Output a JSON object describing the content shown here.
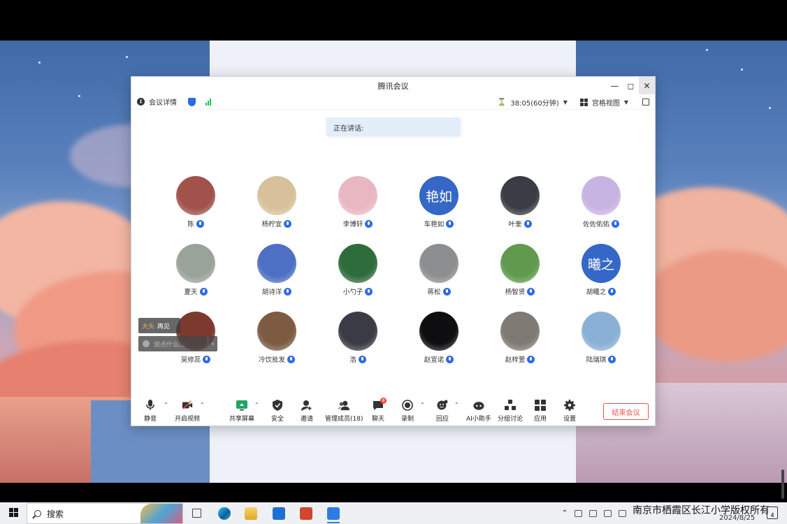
{
  "window": {
    "title": "腾讯会议",
    "meeting_details": "会议详情",
    "timer": "38:05(60分钟)",
    "view_mode": "宫格视图",
    "speaking_label": "正在讲话:"
  },
  "participants": [
    {
      "name": "陈",
      "kind": "photo",
      "color": "#a0524b"
    },
    {
      "name": "杨柠宜",
      "kind": "photo",
      "color": "#d8c09a"
    },
    {
      "name": "李博轩",
      "kind": "photo",
      "color": "#e8b7c2"
    },
    {
      "name": "车艳如",
      "kind": "text",
      "avatar_text": "艳如"
    },
    {
      "name": "叶奎",
      "kind": "photo",
      "color": "#3a3d46"
    },
    {
      "name": "佐佐佑佑",
      "kind": "photo",
      "color": "#c8b4e3"
    },
    {
      "name": "夏天",
      "kind": "photo",
      "color": "#9aa39a"
    },
    {
      "name": "胡诗洋",
      "kind": "photo",
      "color": "#4d6fc4"
    },
    {
      "name": "小勺子",
      "kind": "photo",
      "color": "#2f6c3c"
    },
    {
      "name": "蒋松",
      "kind": "photo",
      "color": "#8d8e90"
    },
    {
      "name": "杨智贤",
      "kind": "photo",
      "color": "#5f9a4e"
    },
    {
      "name": "胡曦之",
      "kind": "text",
      "avatar_text": "曦之"
    },
    {
      "name": "吴修蕊",
      "kind": "photo",
      "color": "#7c3a2e"
    },
    {
      "name": "冷饮批发",
      "kind": "photo",
      "color": "#7d5b43"
    },
    {
      "name": "浩",
      "kind": "photo",
      "color": "#3b3b45"
    },
    {
      "name": "赵宣诺",
      "kind": "photo",
      "color": "#0e0e10"
    },
    {
      "name": "赵梓萱",
      "kind": "photo",
      "color": "#7e7a73"
    },
    {
      "name": "陆瑞琪",
      "kind": "photo",
      "color": "#8ab0d6"
    }
  ],
  "chat": {
    "sender": "大头",
    "message": "再见",
    "input_placeholder": "说点什么..."
  },
  "controls": {
    "mute": "静音",
    "video": "开启视频",
    "share": "共享屏幕",
    "security": "安全",
    "invite": "邀请",
    "members": "管理成员(18)",
    "chat": "聊天",
    "chat_badge": "8",
    "record": "录制",
    "reaction": "回应",
    "ai_assistant": "AI小助手",
    "breakout": "分组讨论",
    "apps": "应用",
    "settings": "设置",
    "end_meeting": "结束会议"
  },
  "taskbar": {
    "search_label": "搜索",
    "watermark": "南京市栖霞区长江小学版权所有",
    "date": "2024/8/25",
    "notification_count": "4"
  },
  "colors": {
    "accent": "#2d6be6",
    "end_meeting": "#e8524f",
    "avatar_text_bg": "#3567c6"
  }
}
